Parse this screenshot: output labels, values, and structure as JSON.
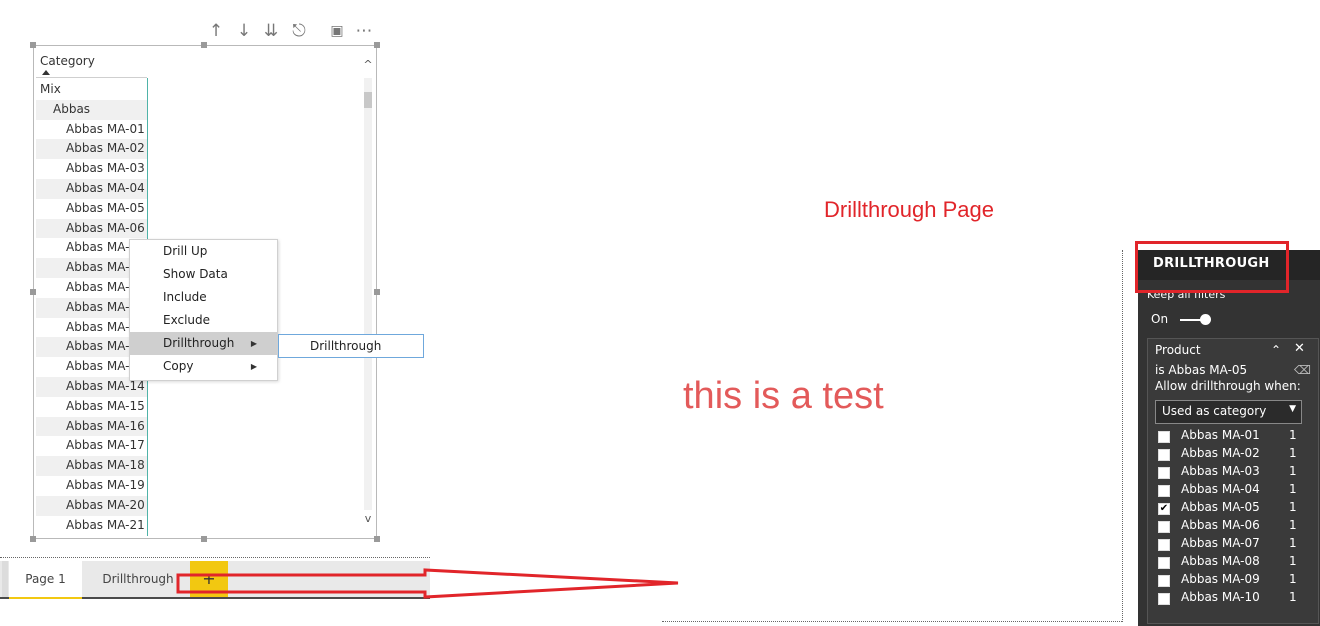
{
  "visual_toolbar": {
    "icons": [
      "arrow-up-icon",
      "arrow-down-icon",
      "double-arrow-down-icon",
      "expand-hierarchy-icon",
      "focus-mode-icon",
      "more-options-icon"
    ]
  },
  "matrix": {
    "column_header": "Category",
    "rows": [
      {
        "label": "Mix",
        "level": 0
      },
      {
        "label": "Abbas",
        "level": 1
      },
      {
        "label": "Abbas MA-01",
        "level": 2
      },
      {
        "label": "Abbas MA-02",
        "level": 2
      },
      {
        "label": "Abbas MA-03",
        "level": 2
      },
      {
        "label": "Abbas MA-04",
        "level": 2
      },
      {
        "label": "Abbas MA-05",
        "level": 2
      },
      {
        "label": "Abbas MA-06",
        "level": 2
      },
      {
        "label": "Abbas MA-0",
        "level": 2
      },
      {
        "label": "Abbas MA-0",
        "level": 2
      },
      {
        "label": "Abbas MA-0",
        "level": 2
      },
      {
        "label": "Abbas MA-1",
        "level": 2
      },
      {
        "label": "Abbas MA-1",
        "level": 2
      },
      {
        "label": "Abbas MA-1",
        "level": 2
      },
      {
        "label": "Abbas MA-1",
        "level": 2
      },
      {
        "label": "Abbas MA-14",
        "level": 2
      },
      {
        "label": "Abbas MA-15",
        "level": 2
      },
      {
        "label": "Abbas MA-16",
        "level": 2
      },
      {
        "label": "Abbas MA-17",
        "level": 2
      },
      {
        "label": "Abbas MA-18",
        "level": 2
      },
      {
        "label": "Abbas MA-19",
        "level": 2
      },
      {
        "label": "Abbas MA-20",
        "level": 2
      },
      {
        "label": "Abbas MA-21",
        "level": 2
      }
    ],
    "scroll_up": "^",
    "scroll_down": "v"
  },
  "context_menu": {
    "items": [
      {
        "label": "Drill Up",
        "has_submenu": false
      },
      {
        "label": "Show Data",
        "has_submenu": false
      },
      {
        "label": "Include",
        "has_submenu": false
      },
      {
        "label": "Exclude",
        "has_submenu": false
      },
      {
        "label": "Drillthrough",
        "has_submenu": true,
        "active": true
      },
      {
        "label": "Copy",
        "has_submenu": true
      }
    ],
    "submenu_item": "Drillthrough"
  },
  "page_tabs": {
    "tabs": [
      "Page 1",
      "Drillthrough"
    ],
    "add_label": "+"
  },
  "annotations": {
    "page_title": "Drillthrough Page",
    "test_text": "this is a test"
  },
  "drillthrough_pane": {
    "title": "DRILLTHROUGH",
    "keep_filters_label": "Keep all filters",
    "toggle_label": "On",
    "filter_card": {
      "field": "Product",
      "condition": "is Abbas MA-05",
      "allow_label": "Allow drillthrough when:",
      "select_value": "Used as category",
      "items": [
        {
          "name": "Abbas MA-01",
          "count": "1",
          "checked": false
        },
        {
          "name": "Abbas MA-02",
          "count": "1",
          "checked": false
        },
        {
          "name": "Abbas MA-03",
          "count": "1",
          "checked": false
        },
        {
          "name": "Abbas MA-04",
          "count": "1",
          "checked": false
        },
        {
          "name": "Abbas MA-05",
          "count": "1",
          "checked": true
        },
        {
          "name": "Abbas MA-06",
          "count": "1",
          "checked": false
        },
        {
          "name": "Abbas MA-07",
          "count": "1",
          "checked": false
        },
        {
          "name": "Abbas MA-08",
          "count": "1",
          "checked": false
        },
        {
          "name": "Abbas MA-09",
          "count": "1",
          "checked": false
        },
        {
          "name": "Abbas MA-10",
          "count": "1",
          "checked": false
        }
      ]
    }
  },
  "colors": {
    "annotation_red": "#e1252a",
    "tab_highlight": "#f2c811",
    "pane_bg": "#333333"
  }
}
